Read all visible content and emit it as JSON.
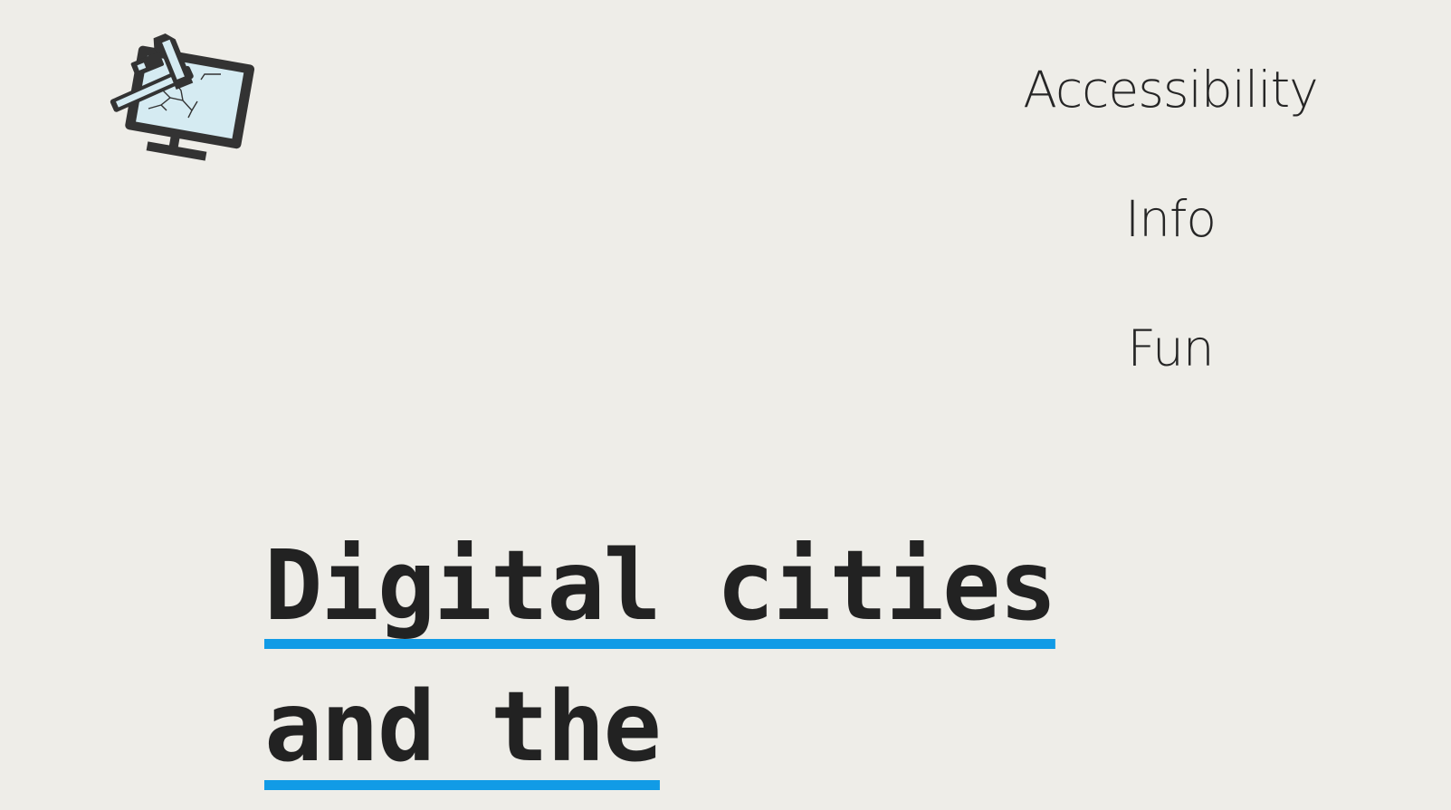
{
  "site": {
    "logo_icon": "broken-computer-monitor-icon",
    "nav": [
      {
        "label": "Accessibility"
      },
      {
        "label": "Info"
      },
      {
        "label": "Fun"
      }
    ]
  },
  "hero": {
    "headline": "Digital cities and the"
  },
  "colors": {
    "background": "#eeede8",
    "text": "#262626",
    "underline": "#119be6",
    "screen": "#d5ebf2"
  }
}
